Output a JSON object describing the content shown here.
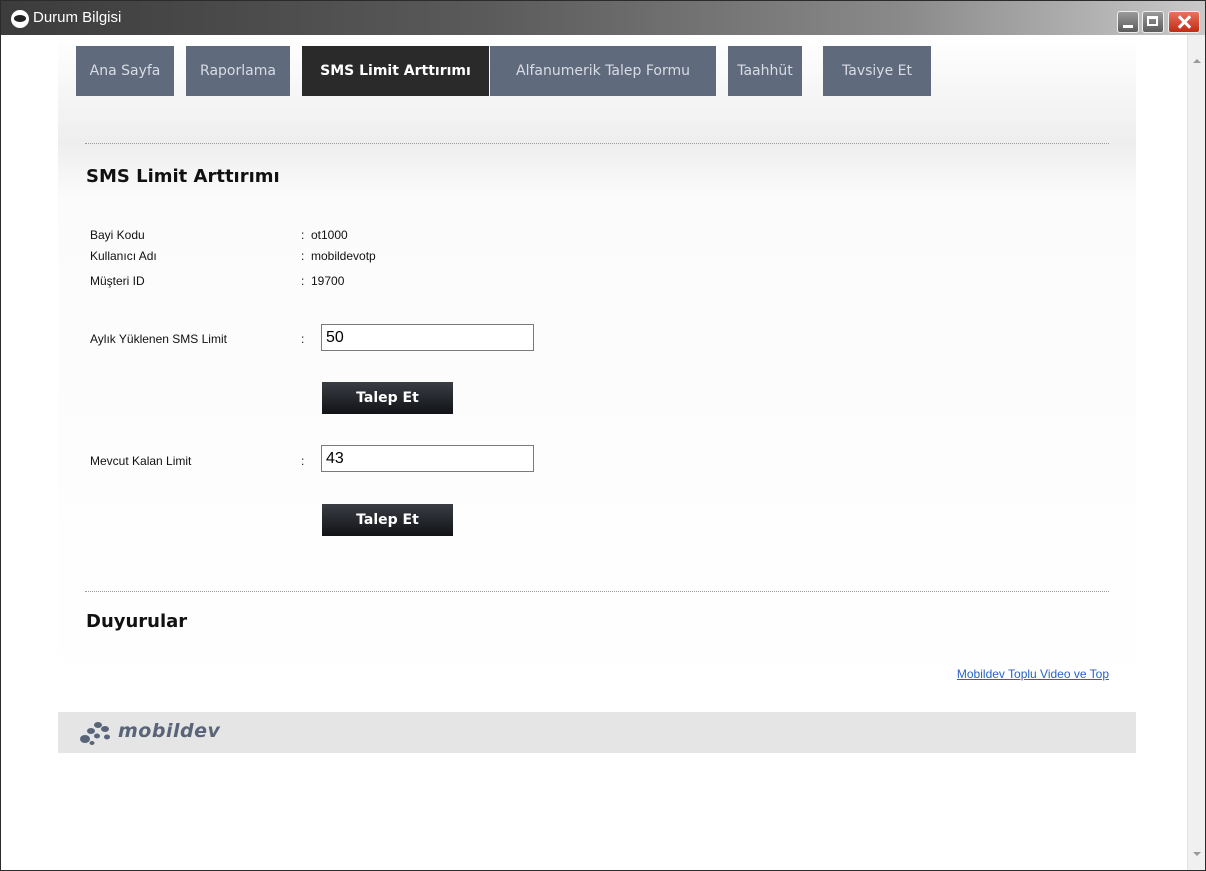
{
  "window": {
    "title": "Durum Bilgisi"
  },
  "tabs": [
    {
      "label": "Ana Sayfa",
      "active": false
    },
    {
      "label": "Raporlama",
      "active": false
    },
    {
      "label": "SMS Limit Arttırımı",
      "active": true
    },
    {
      "label": "Alfanumerik Talep Formu",
      "active": false
    },
    {
      "label": "Taahhüt",
      "active": false
    },
    {
      "label": "Tavsiye Et",
      "active": false
    }
  ],
  "section": {
    "title": "SMS Limit Arttırımı",
    "info": [
      {
        "label": "Bayi Kodu",
        "value": "ot1000"
      },
      {
        "label": "Kullanıcı Adı",
        "value": "mobildevotp"
      },
      {
        "label": "Müşteri ID",
        "value": "19700"
      }
    ],
    "separator": ":",
    "monthly": {
      "label": "Aylık Yüklenen SMS Limit",
      "value": "50",
      "button": "Talep Et"
    },
    "remaining": {
      "label": "Mevcut Kalan Limit",
      "value": "43",
      "button": "Talep Et"
    }
  },
  "announcements": {
    "title": "Duyurular",
    "link": "Mobildev Toplu Video ve Top"
  },
  "footer": {
    "logo_text": "mobildev",
    "logo_mark": "·"
  },
  "colors": {
    "tab_bg": "#5f6a7c",
    "tab_active_bg": "#2a2a2a",
    "link": "#2c5fc7"
  }
}
